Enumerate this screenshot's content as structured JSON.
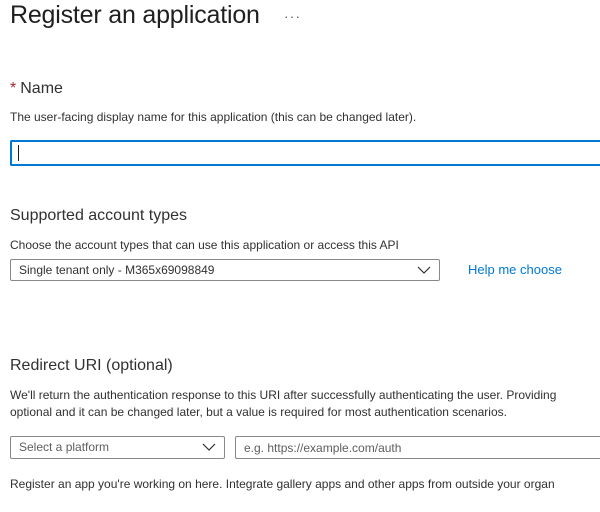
{
  "header": {
    "title": "Register an application",
    "more_label": "···"
  },
  "name_section": {
    "required_marker": "*",
    "label": "Name",
    "description": "The user-facing display name for this application (this can be changed later).",
    "input_value": ""
  },
  "account_types": {
    "label": "Supported account types",
    "description": "Choose the account types that can use this application or access this API",
    "selected_value": "Single tenant only - M365x69098849",
    "help_link": "Help me choose"
  },
  "redirect_uri": {
    "label": "Redirect URI (optional)",
    "description_line1": "We'll return the authentication response to this URI after successfully authenticating the user. Providing",
    "description_line2": "optional and it can be changed later, but a value is required for most authentication scenarios.",
    "platform_placeholder": "Select a platform",
    "uri_placeholder": "e.g. https://example.com/auth"
  },
  "footer": {
    "text": "Register an app you're working on here. Integrate gallery apps and other apps from outside your organ"
  },
  "icons": {
    "dropdown": "chevron-down-icon",
    "more": "more-horizontal-icon"
  },
  "colors": {
    "accent": "#0078d4",
    "required": "#a4262c",
    "text": "#323130",
    "border": "#8a8886"
  }
}
